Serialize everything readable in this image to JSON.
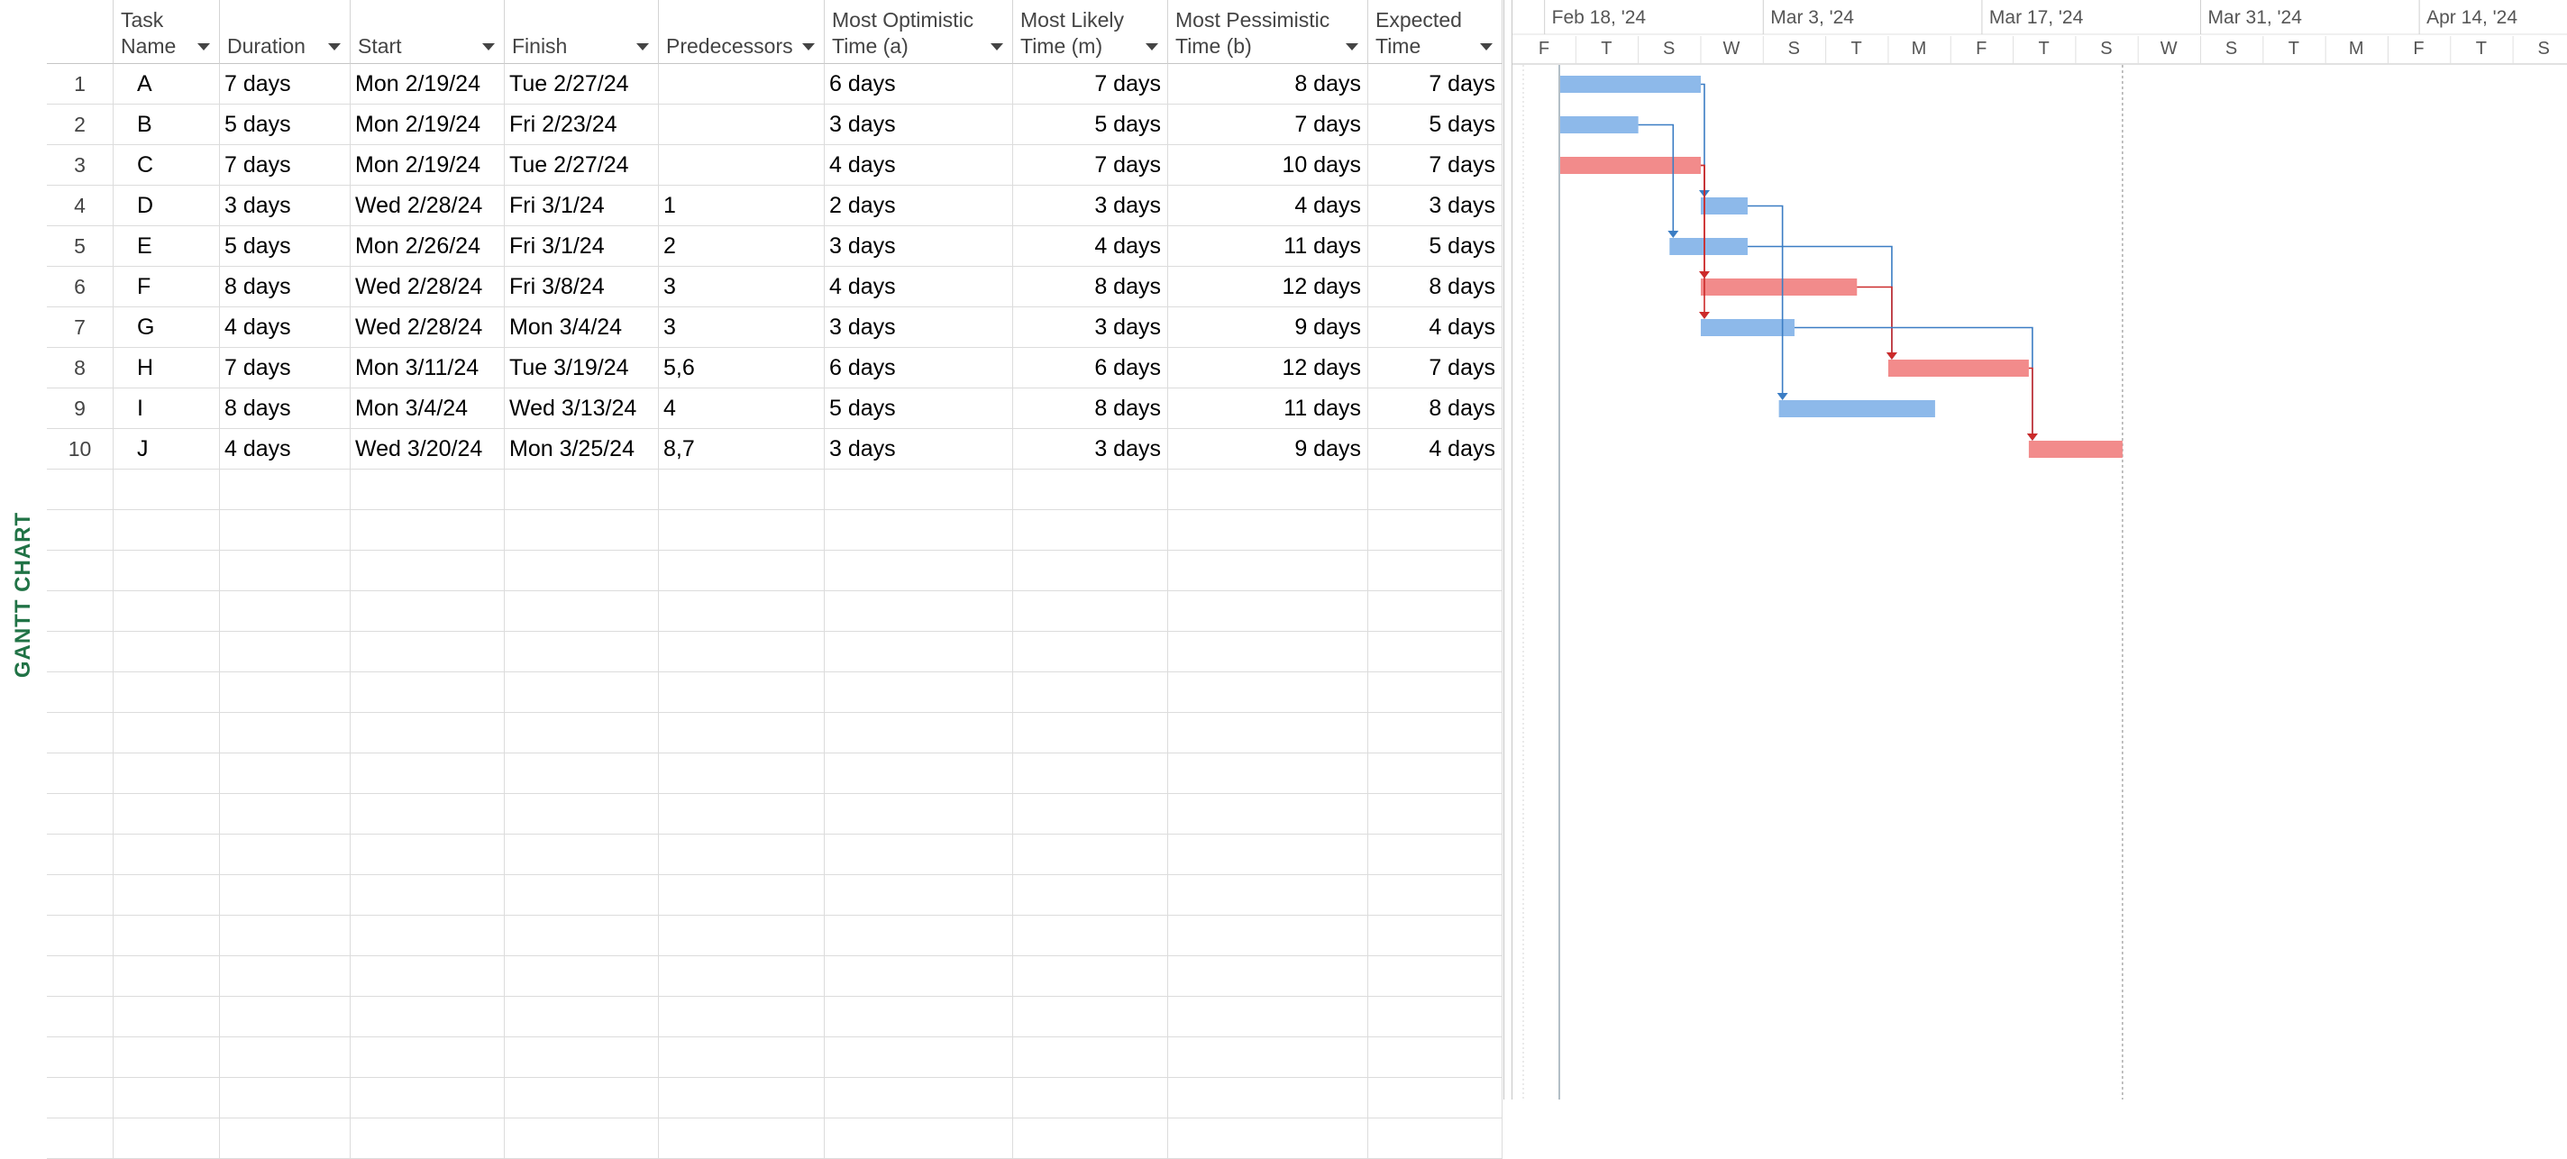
{
  "view_label": "GANTT CHART",
  "columns": [
    {
      "key": "id",
      "label": ""
    },
    {
      "key": "name",
      "label": "Task\nName"
    },
    {
      "key": "duration",
      "label": "Duration"
    },
    {
      "key": "start",
      "label": "Start"
    },
    {
      "key": "finish",
      "label": "Finish"
    },
    {
      "key": "pred",
      "label": "Predecessors"
    },
    {
      "key": "opt",
      "label": "Most Optimistic\nTime (a)"
    },
    {
      "key": "likely",
      "label": "Most Likely\nTime (m)"
    },
    {
      "key": "pess",
      "label": "Most Pessimistic\nTime (b)"
    },
    {
      "key": "exp",
      "label": "Expected\nTime"
    }
  ],
  "tasks": [
    {
      "id": "1",
      "name": "A",
      "duration": "7 days",
      "start": "Mon 2/19/24",
      "finish": "Tue 2/27/24",
      "pred": "",
      "opt": "6 days",
      "likely": "7 days",
      "pess": "8 days",
      "exp": "7 days",
      "critical": false
    },
    {
      "id": "2",
      "name": "B",
      "duration": "5 days",
      "start": "Mon 2/19/24",
      "finish": "Fri 2/23/24",
      "pred": "",
      "opt": "3 days",
      "likely": "5 days",
      "pess": "7 days",
      "exp": "5 days",
      "critical": false
    },
    {
      "id": "3",
      "name": "C",
      "duration": "7 days",
      "start": "Mon 2/19/24",
      "finish": "Tue 2/27/24",
      "pred": "",
      "opt": "4 days",
      "likely": "7 days",
      "pess": "10 days",
      "exp": "7 days",
      "critical": true
    },
    {
      "id": "4",
      "name": "D",
      "duration": "3 days",
      "start": "Wed 2/28/24",
      "finish": "Fri 3/1/24",
      "pred": "1",
      "opt": "2 days",
      "likely": "3 days",
      "pess": "4 days",
      "exp": "3 days",
      "critical": false
    },
    {
      "id": "5",
      "name": "E",
      "duration": "5 days",
      "start": "Mon 2/26/24",
      "finish": "Fri 3/1/24",
      "pred": "2",
      "opt": "3 days",
      "likely": "4 days",
      "pess": "11 days",
      "exp": "5 days",
      "critical": false
    },
    {
      "id": "6",
      "name": "F",
      "duration": "8 days",
      "start": "Wed 2/28/24",
      "finish": "Fri 3/8/24",
      "pred": "3",
      "opt": "4 days",
      "likely": "8 days",
      "pess": "12 days",
      "exp": "8 days",
      "critical": true
    },
    {
      "id": "7",
      "name": "G",
      "duration": "4 days",
      "start": "Wed 2/28/24",
      "finish": "Mon 3/4/24",
      "pred": "3",
      "opt": "3 days",
      "likely": "3 days",
      "pess": "9 days",
      "exp": "4 days",
      "critical": false
    },
    {
      "id": "8",
      "name": "H",
      "duration": "7 days",
      "start": "Mon 3/11/24",
      "finish": "Tue 3/19/24",
      "pred": "5,6",
      "opt": "6 days",
      "likely": "6 days",
      "pess": "12 days",
      "exp": "7 days",
      "critical": true
    },
    {
      "id": "9",
      "name": "I",
      "duration": "8 days",
      "start": "Mon 3/4/24",
      "finish": "Wed 3/13/24",
      "pred": "4",
      "opt": "5 days",
      "likely": "8 days",
      "pess": "11 days",
      "exp": "8 days",
      "critical": false
    },
    {
      "id": "10",
      "name": "J",
      "duration": "4 days",
      "start": "Wed 3/20/24",
      "finish": "Mon 3/25/24",
      "pred": "8,7",
      "opt": "3 days",
      "likely": "3 days",
      "pess": "9 days",
      "exp": "4 days",
      "critical": true
    }
  ],
  "timescale": {
    "major": [
      "Feb 18, '24",
      "Mar 3, '24",
      "Mar 17, '24",
      "Mar 31, '24",
      "Apr 14, '24"
    ],
    "minor": [
      "F",
      "T",
      "S",
      "W",
      "S",
      "T",
      "M",
      "F",
      "T",
      "S",
      "W",
      "S",
      "T",
      "M",
      "F",
      "T",
      "S"
    ],
    "first_day": "2024-02-16",
    "minor_step_days": 4
  },
  "gantt": {
    "bars": [
      {
        "task": "A",
        "start": "2024-02-19",
        "end": "2024-02-28",
        "critical": false
      },
      {
        "task": "B",
        "start": "2024-02-19",
        "end": "2024-02-24",
        "critical": false
      },
      {
        "task": "C",
        "start": "2024-02-19",
        "end": "2024-02-28",
        "critical": true
      },
      {
        "task": "D",
        "start": "2024-02-28",
        "end": "2024-03-02",
        "critical": false
      },
      {
        "task": "E",
        "start": "2024-02-26",
        "end": "2024-03-02",
        "critical": false
      },
      {
        "task": "F",
        "start": "2024-02-28",
        "end": "2024-03-09",
        "critical": true
      },
      {
        "task": "G",
        "start": "2024-02-28",
        "end": "2024-03-05",
        "critical": false
      },
      {
        "task": "H",
        "start": "2024-03-11",
        "end": "2024-03-20",
        "critical": true
      },
      {
        "task": "I",
        "start": "2024-03-04",
        "end": "2024-03-14",
        "critical": false
      },
      {
        "task": "J",
        "start": "2024-03-20",
        "end": "2024-03-26",
        "critical": true
      }
    ],
    "links": [
      {
        "from": "A",
        "to": "D",
        "critical": false
      },
      {
        "from": "B",
        "to": "E",
        "critical": false
      },
      {
        "from": "C",
        "to": "F",
        "critical": true
      },
      {
        "from": "C",
        "to": "G",
        "critical": true
      },
      {
        "from": "D",
        "to": "I",
        "critical": false
      },
      {
        "from": "E",
        "to": "H",
        "critical": false
      },
      {
        "from": "F",
        "to": "H",
        "critical": true
      },
      {
        "from": "G",
        "to": "J",
        "critical": false
      },
      {
        "from": "H",
        "to": "J",
        "critical": true
      }
    ],
    "colors": {
      "normal": "#8db9ea",
      "critical": "#f28b8b",
      "link_normal": "#3b7dc4",
      "link_critical": "#cc2a2a",
      "grid": "#e1e1e1",
      "header_text": "#555555"
    }
  }
}
